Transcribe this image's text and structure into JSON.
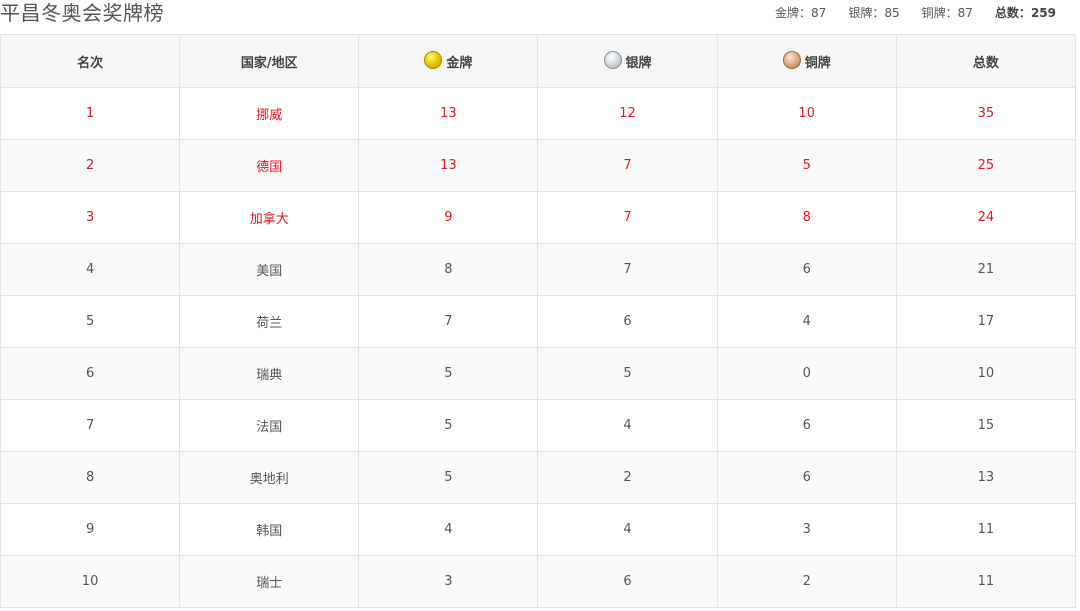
{
  "title": "平昌冬奥会奖牌榜",
  "totals": {
    "gold_label": "金牌：",
    "gold": "87",
    "silver_label": "银牌：",
    "silver": "85",
    "bronze_label": "铜牌：",
    "bronze": "87",
    "total_label": "总数：",
    "total": "259"
  },
  "columns": {
    "rank": "名次",
    "country": "国家/地区",
    "gold": "金牌",
    "silver": "银牌",
    "bronze": "铜牌",
    "total": "总数"
  },
  "icons": {
    "gold": "gold-medal-icon",
    "silver": "silver-medal-icon",
    "bronze": "bronze-medal-icon"
  },
  "colors": {
    "highlight": "#e5161f",
    "text": "#555555",
    "header_bg": "#f6f6f6"
  },
  "rows": [
    {
      "rank": "1",
      "country": "挪威",
      "gold": "13",
      "silver": "12",
      "bronze": "10",
      "total": "35"
    },
    {
      "rank": "2",
      "country": "德国",
      "gold": "13",
      "silver": "7",
      "bronze": "5",
      "total": "25"
    },
    {
      "rank": "3",
      "country": "加拿大",
      "gold": "9",
      "silver": "7",
      "bronze": "8",
      "total": "24"
    },
    {
      "rank": "4",
      "country": "美国",
      "gold": "8",
      "silver": "7",
      "bronze": "6",
      "total": "21"
    },
    {
      "rank": "5",
      "country": "荷兰",
      "gold": "7",
      "silver": "6",
      "bronze": "4",
      "total": "17"
    },
    {
      "rank": "6",
      "country": "瑞典",
      "gold": "5",
      "silver": "5",
      "bronze": "0",
      "total": "10"
    },
    {
      "rank": "7",
      "country": "法国",
      "gold": "5",
      "silver": "4",
      "bronze": "6",
      "total": "15"
    },
    {
      "rank": "8",
      "country": "奥地利",
      "gold": "5",
      "silver": "2",
      "bronze": "6",
      "total": "13"
    },
    {
      "rank": "9",
      "country": "韩国",
      "gold": "4",
      "silver": "4",
      "bronze": "3",
      "total": "11"
    },
    {
      "rank": "10",
      "country": "瑞士",
      "gold": "3",
      "silver": "6",
      "bronze": "2",
      "total": "11"
    }
  ]
}
